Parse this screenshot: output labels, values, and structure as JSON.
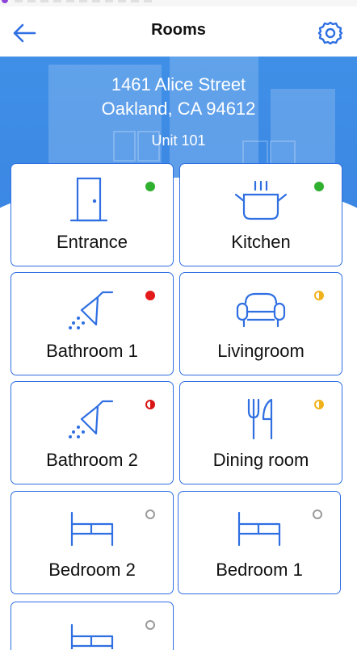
{
  "header": {
    "title": "Rooms"
  },
  "address": {
    "line1": "1461 Alice Street",
    "line2": "Oakland, CA 94612",
    "unit": "Unit 101"
  },
  "rooms": [
    {
      "name": "Entrance",
      "icon": "door-icon",
      "status": "green"
    },
    {
      "name": "Kitchen",
      "icon": "pot-icon",
      "status": "green"
    },
    {
      "name": "Bathroom 1",
      "icon": "shower-icon",
      "status": "red"
    },
    {
      "name": "Livingroom",
      "icon": "armchair-icon",
      "status": "yellow-half"
    },
    {
      "name": "Bathroom 2",
      "icon": "shower-icon",
      "status": "red-half"
    },
    {
      "name": "Dining room",
      "icon": "utensils-icon",
      "status": "yellow-half"
    },
    {
      "name": "Bedroom 2",
      "icon": "bed-icon",
      "status": "empty"
    },
    {
      "name": "Bedroom 1",
      "icon": "bed-icon",
      "status": "empty"
    },
    {
      "name": "",
      "icon": "bed-icon",
      "status": "empty"
    }
  ],
  "colors": {
    "accent": "#2f6fe2",
    "hero": "#3b87e3",
    "green": "#2fb02f",
    "red": "#e41919",
    "yellow": "#f0b21a",
    "gray": "#9a9a9a"
  }
}
